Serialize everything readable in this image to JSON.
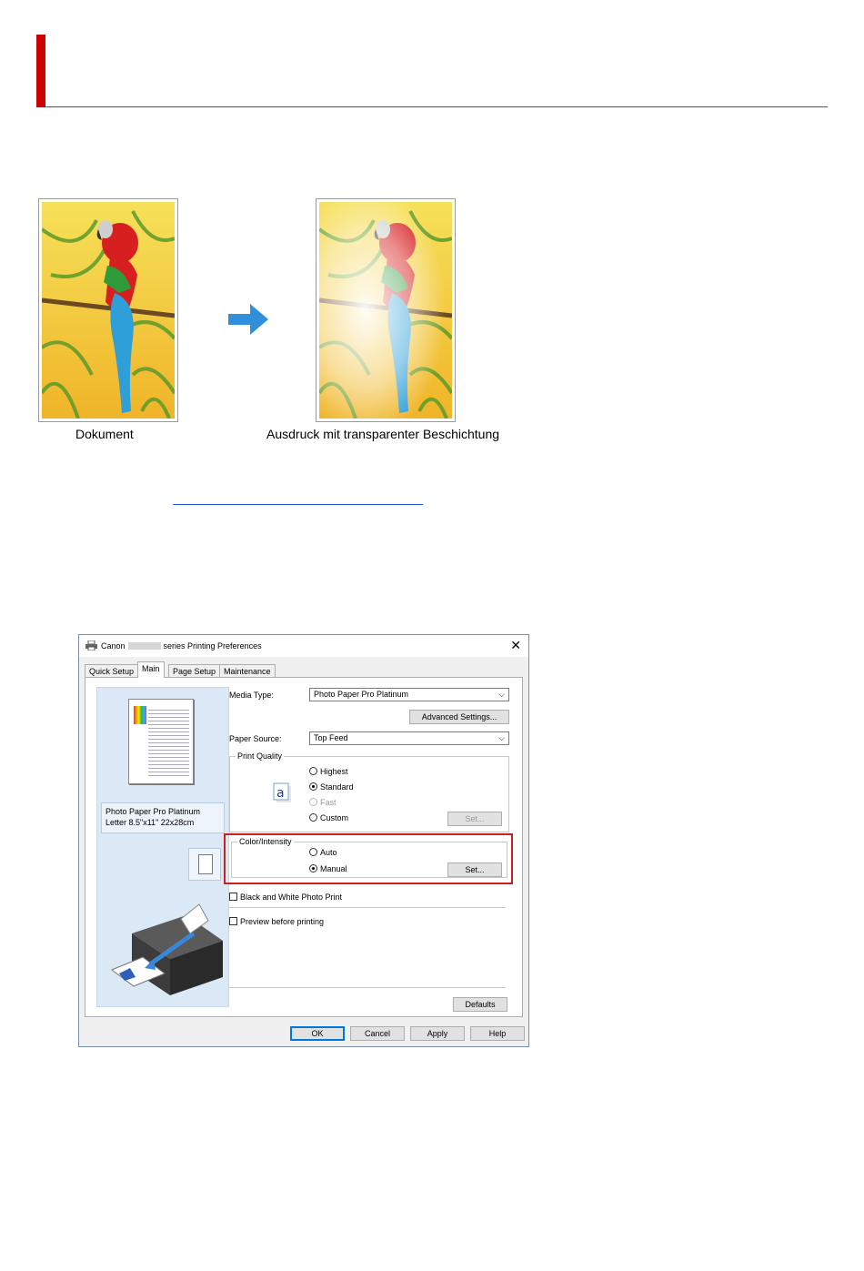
{
  "figure": {
    "caption_left": "Dokument",
    "caption_right": "Ausdruck mit transparenter Beschichtung"
  },
  "dialog": {
    "title_prefix": "Canon",
    "title_suffix": "series Printing Preferences",
    "tabs": [
      "Quick Setup",
      "Main",
      "Page Setup",
      "Maintenance"
    ],
    "media_type_label": "Media Type:",
    "media_type_value": "Photo Paper Pro Platinum",
    "advanced_settings": "Advanced Settings...",
    "paper_source_label": "Paper Source:",
    "paper_source_value": "Top Feed",
    "print_quality_label": "Print Quality",
    "quality_options": [
      "Highest",
      "Standard",
      "Fast",
      "Custom"
    ],
    "quality_set": "Set...",
    "color_intensity_label": "Color/Intensity",
    "color_options": [
      "Auto",
      "Manual"
    ],
    "color_set": "Set...",
    "bw_photo": "Black and White Photo Print",
    "preview_before": "Preview before printing",
    "defaults": "Defaults",
    "media_info_line1": "Photo Paper Pro Platinum",
    "media_info_line2": "Letter 8.5\"x11\" 22x28cm",
    "ok": "OK",
    "cancel": "Cancel",
    "apply": "Apply",
    "help": "Help"
  },
  "colors": {
    "accent_red": "#cc0000",
    "arrow_blue": "#2f8fd8"
  }
}
